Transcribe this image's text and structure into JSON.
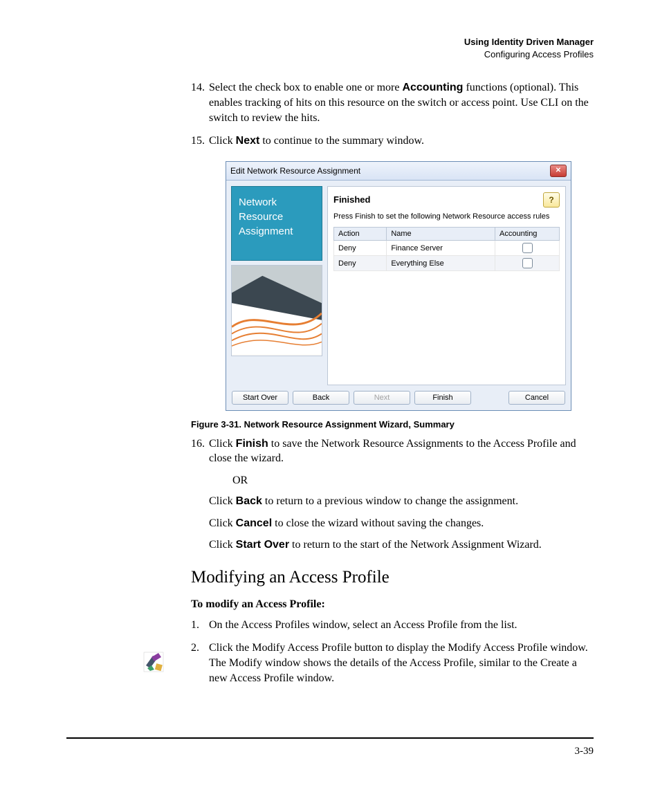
{
  "header": {
    "title": "Using Identity Driven Manager",
    "subtitle": "Configuring Access Profiles"
  },
  "step14": {
    "num": "14.",
    "t1": "Select the check box to enable one or more ",
    "bold": "Accounting",
    "t2": " functions (optional). This enables tracking of hits on this resource on the switch or access point. Use CLI on the switch to review the hits."
  },
  "step15": {
    "num": "15.",
    "t1": "Click ",
    "bold": "Next",
    "t2": " to continue to the summary window."
  },
  "dialog": {
    "title": "Edit Network Resource Assignment",
    "panel_title": "Network\nResource\nAssignment",
    "finished": "Finished",
    "desc": "Press Finish to set the following Network Resource access rules",
    "cols": {
      "action": "Action",
      "name": "Name",
      "acct": "Accounting"
    },
    "rows": [
      {
        "action": "Deny",
        "name": "Finance Server"
      },
      {
        "action": "Deny",
        "name": "Everything Else"
      }
    ],
    "buttons": {
      "start_over": "Start Over",
      "back": "Back",
      "next": "Next",
      "finish": "Finish",
      "cancel": "Cancel"
    }
  },
  "caption": "Figure 3-31. Network Resource Assignment Wizard, Summary",
  "step16": {
    "num": "16.",
    "t1": "Click ",
    "b1": "Finish",
    "t2": " to save the Network Resource Assignments to the Access Profile and close the wizard.",
    "or": "OR",
    "l2a": "Click ",
    "l2b": "Back",
    "l2c": " to return to a previous window to change the assignment.",
    "l3a": "Click ",
    "l3b": "Cancel",
    "l3c": " to close the wizard without saving the changes.",
    "l4a": "Click ",
    "l4b": "Start Over",
    "l4c": " to return to the start of the Network Assignment Wizard."
  },
  "h2": "Modifying an Access Profile",
  "mod_intro": "To modify an Access Profile:",
  "mod1": {
    "num": "1.",
    "text": "On the Access Profiles window, select an Access Profile from the list."
  },
  "mod2": {
    "num": "2.",
    "text": "Click the Modify Access Profile button to display the Modify Access Profile window. The Modify window shows the details of the Access Profile, similar to the Create a new Access Profile window."
  },
  "page_num": "3-39"
}
